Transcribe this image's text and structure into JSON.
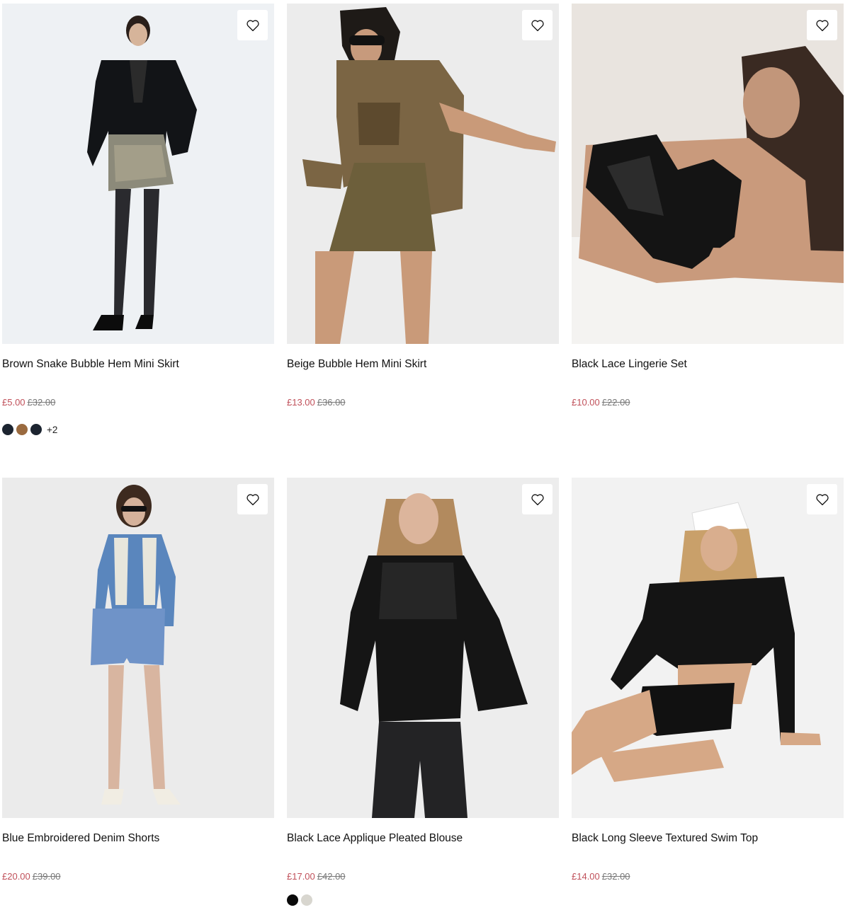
{
  "products": [
    {
      "title": "Brown Snake Bubble Hem Mini Skirt",
      "sale_price": "£5.00",
      "original_price": "£32.00",
      "background": "#eef1f4",
      "swatches": [
        "#1c2430",
        "#9a6a3f",
        "#1c2430"
      ],
      "more_colours": "+2"
    },
    {
      "title": "Beige Bubble Hem Mini Skirt",
      "sale_price": "£13.00",
      "original_price": "£36.00",
      "background": "#ececec",
      "swatches": [],
      "more_colours": ""
    },
    {
      "title": "Black Lace Lingerie Set",
      "sale_price": "£10.00",
      "original_price": "£22.00",
      "background": "#e9e4df",
      "swatches": [],
      "more_colours": ""
    },
    {
      "title": "Blue Embroidered Denim Shorts",
      "sale_price": "£20.00",
      "original_price": "£39.00",
      "background": "#ebebeb",
      "swatches": [],
      "more_colours": ""
    },
    {
      "title": "Black Lace Applique Pleated Blouse",
      "sale_price": "£17.00",
      "original_price": "£42.00",
      "background": "#ededed",
      "swatches": [
        "#0a0a0a",
        "#d8d6cf"
      ],
      "more_colours": ""
    },
    {
      "title": "Black Long Sleeve Textured Swim Top",
      "sale_price": "£14.00",
      "original_price": "£32.00",
      "background": "#f2f2f2",
      "swatches": [],
      "more_colours": ""
    }
  ],
  "icons": {
    "wishlist": "heart-outline-icon"
  },
  "colors": {
    "sale": "#c0505a",
    "was": "#777777"
  }
}
